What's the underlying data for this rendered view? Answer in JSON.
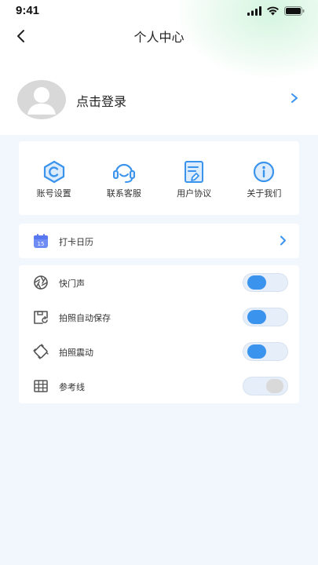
{
  "status": {
    "time": "9:41"
  },
  "header": {
    "title": "个人中心"
  },
  "profile": {
    "login_text": "点击登录"
  },
  "menu": [
    {
      "label": "账号设置",
      "icon": "account-settings-icon"
    },
    {
      "label": "联系客服",
      "icon": "customer-service-icon"
    },
    {
      "label": "用户协议",
      "icon": "user-agreement-icon"
    },
    {
      "label": "关于我们",
      "icon": "about-us-icon"
    }
  ],
  "calendar": {
    "label": "打卡日历",
    "icon_day": "15"
  },
  "settings": [
    {
      "label": "快门声",
      "on": true
    },
    {
      "label": "拍照自动保存",
      "on": true
    },
    {
      "label": "拍照震动",
      "on": true
    },
    {
      "label": "参考线",
      "on": false
    }
  ],
  "colors": {
    "accent": "#3a93ec",
    "background": "#f2f6fd",
    "card": "#ffffff",
    "calendar": "#6f8cf4"
  }
}
